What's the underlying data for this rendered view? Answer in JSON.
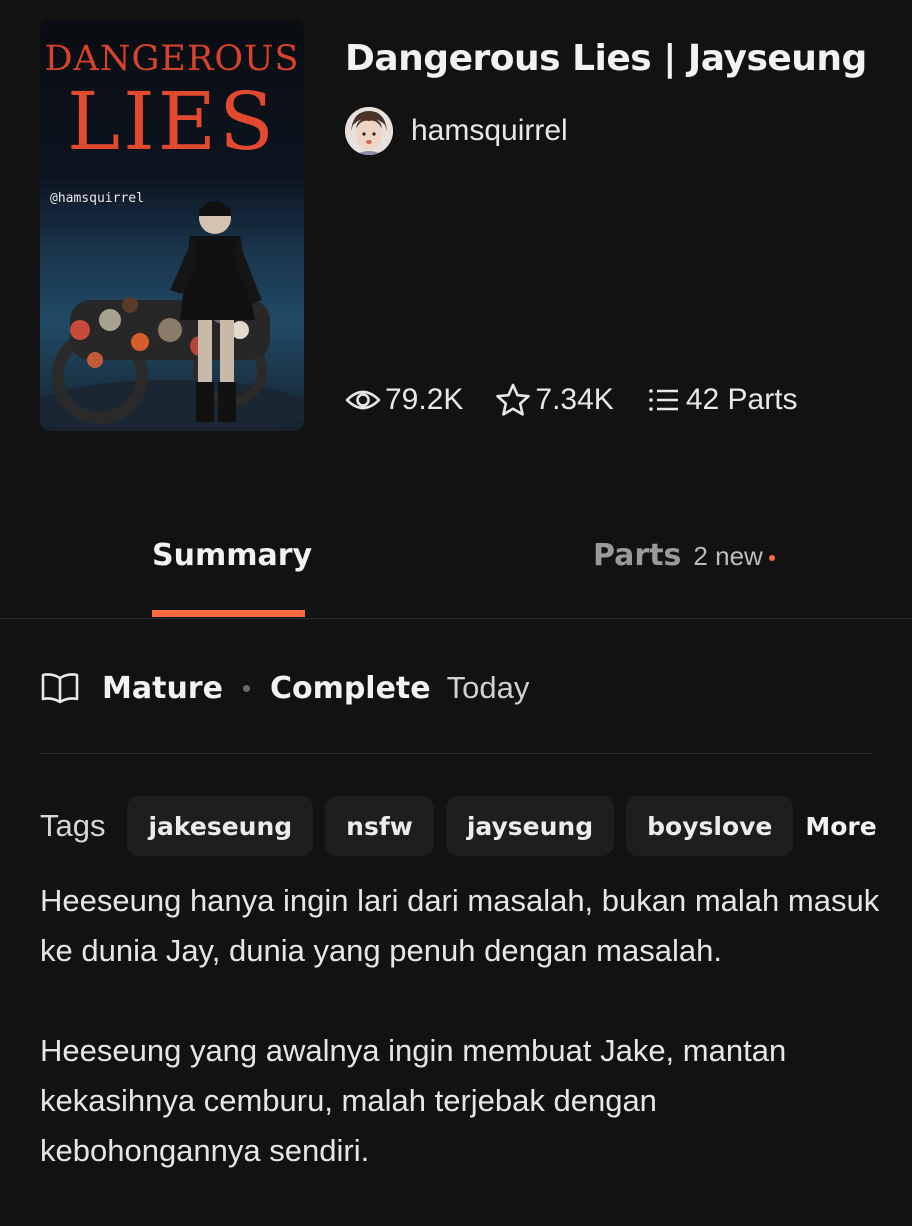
{
  "story": {
    "title": "Dangerous Lies | Jayseung",
    "author": "hamsquirrel",
    "cover": {
      "title_line1": "DANGEROUS",
      "title_line2": "LIES",
      "handle": "@hamsquirrel"
    },
    "stats": {
      "reads": "79.2K",
      "votes": "7.34K",
      "parts": "42 Parts"
    }
  },
  "tabs": {
    "summary_label": "Summary",
    "parts_label": "Parts",
    "parts_new": "2 new"
  },
  "meta": {
    "rating": "Mature",
    "status": "Complete",
    "updated": "Today"
  },
  "tags": {
    "label": "Tags",
    "items": [
      "jakeseung",
      "nsfw",
      "jayseung",
      "boyslove"
    ],
    "more_label": "More"
  },
  "description": {
    "paragraphs": [
      "Heeseung hanya ingin lari dari masalah, bukan malah masuk ke dunia Jay, dunia yang penuh dengan masalah.",
      "Heeseung yang awalnya ingin membuat Jake, mantan kekasihnya cemburu, malah terjebak dengan kebohongannya sendiri."
    ]
  },
  "colors": {
    "background": "#121212",
    "accent": "#ff6a3d",
    "cover_title": "#e24a2f",
    "tag_bg": "#1e1e1e"
  },
  "icons": {
    "reads": "eye-icon",
    "votes": "star-icon",
    "parts": "list-icon",
    "meta": "open-book-icon"
  }
}
